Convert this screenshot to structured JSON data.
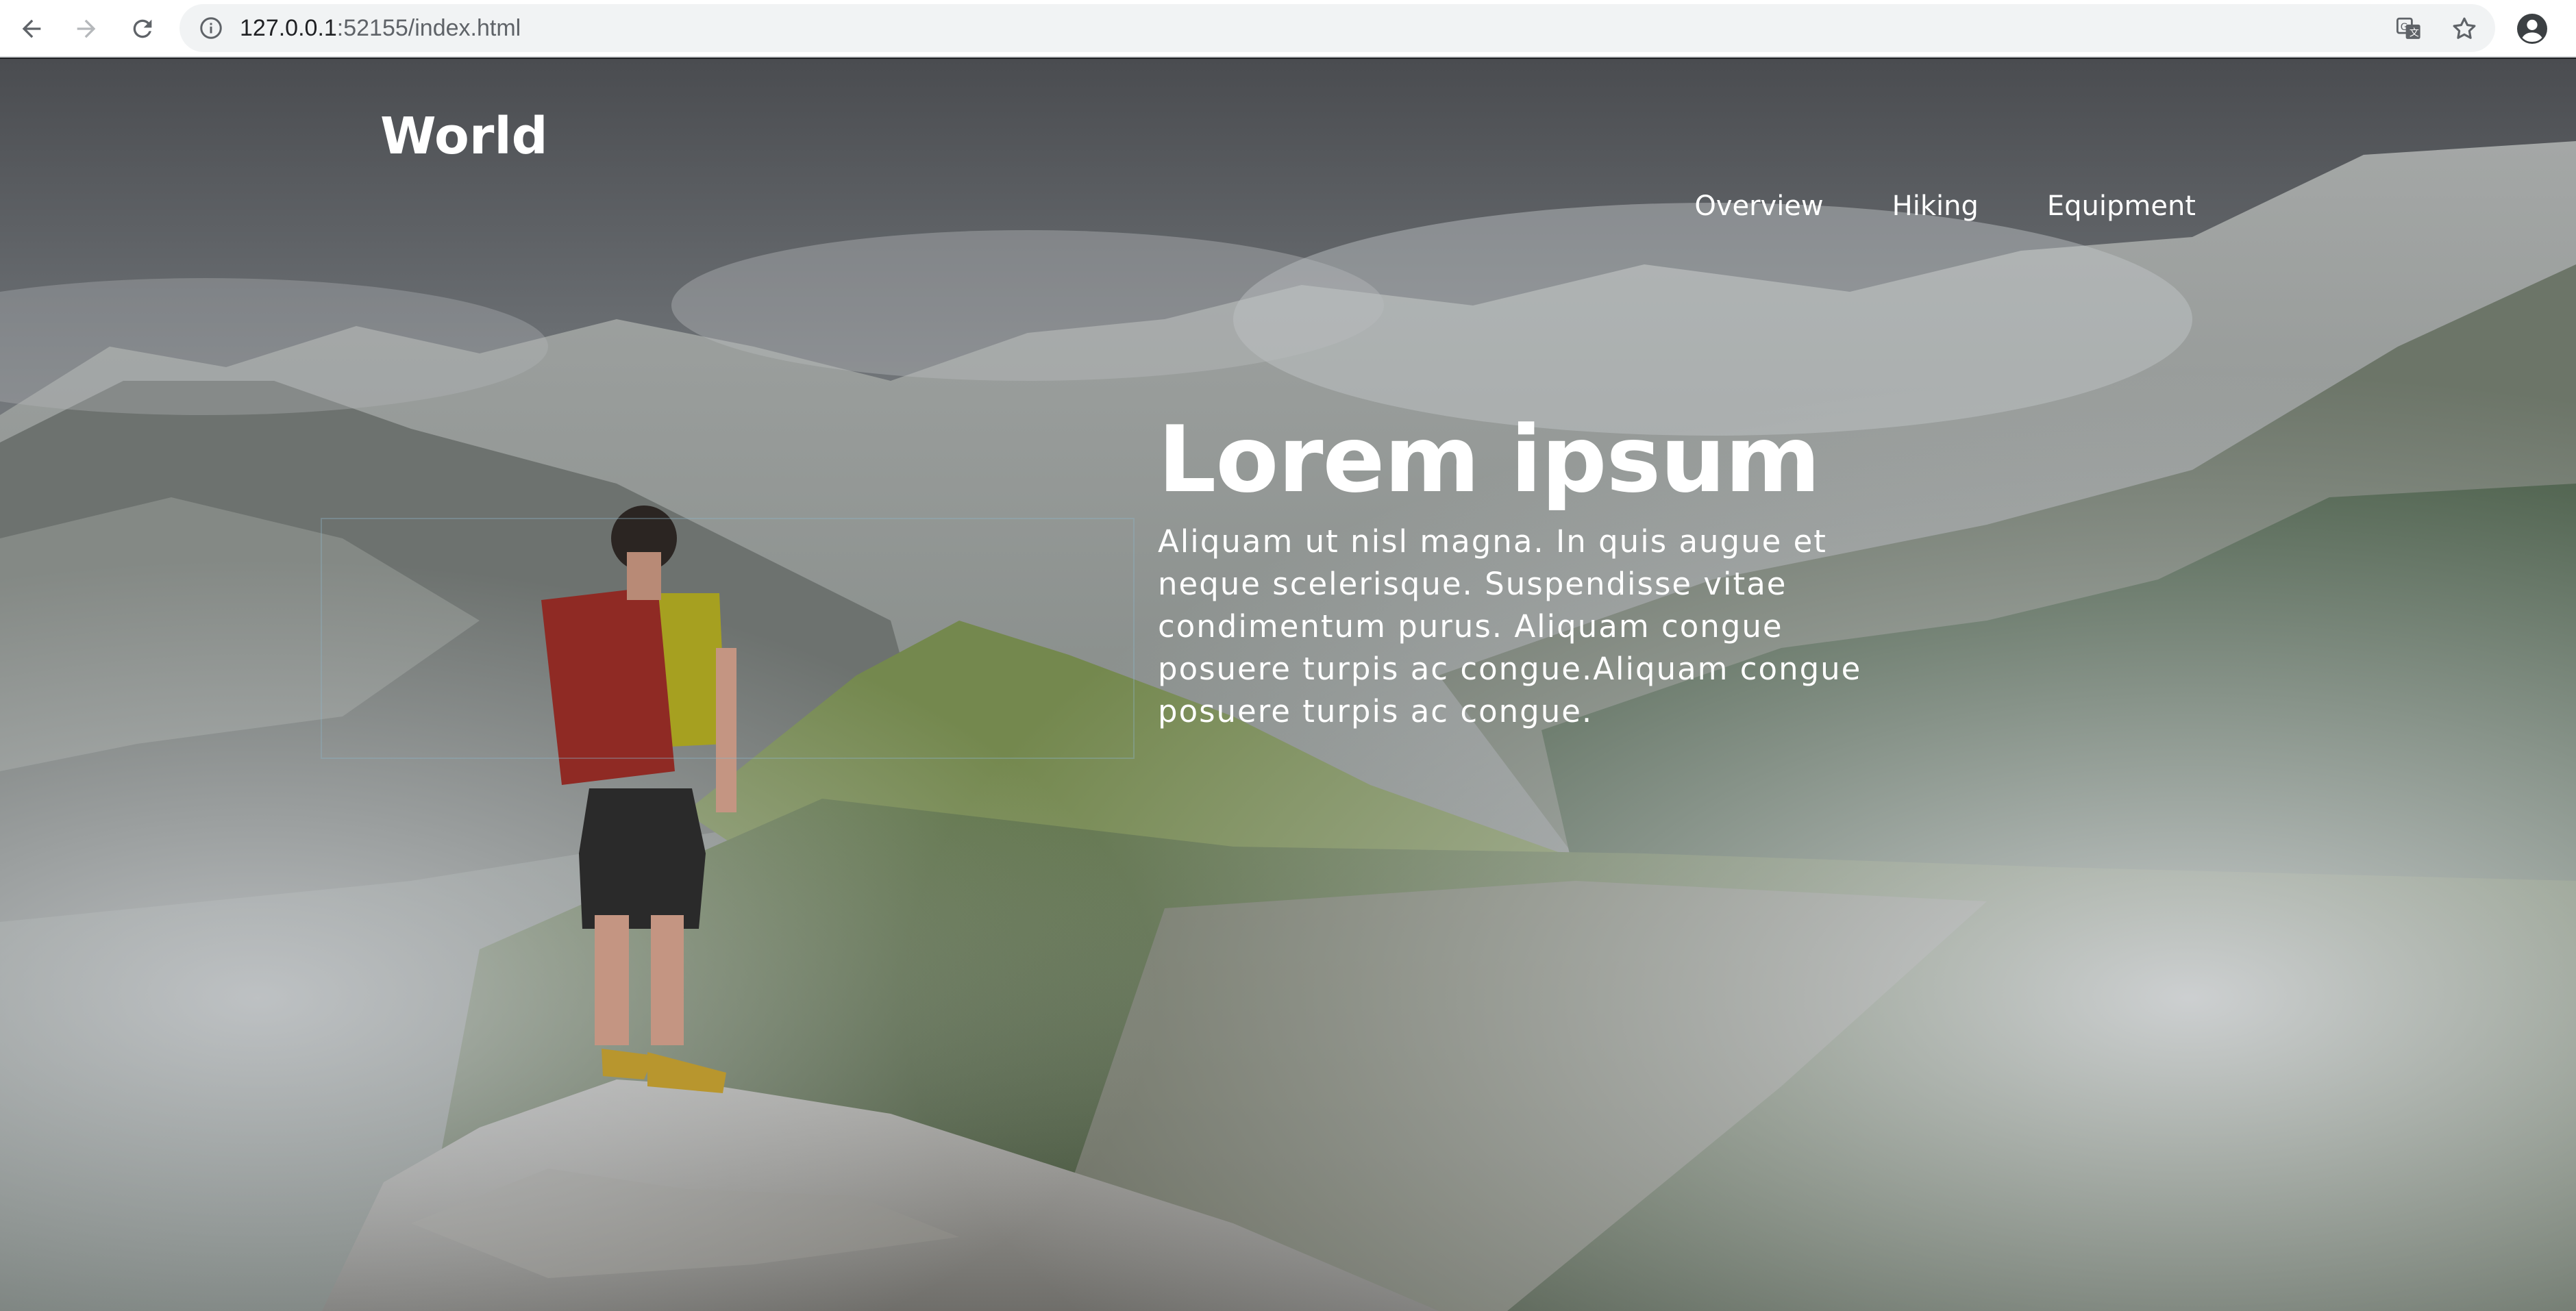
{
  "browser": {
    "url_host": "127.0.0.1",
    "url_path": ":52155/index.html",
    "icons": {
      "back": "arrow-left-icon",
      "forward": "arrow-right-icon",
      "reload": "reload-icon",
      "site_info": "info-icon",
      "translate": "translate-icon",
      "bookmark": "star-icon",
      "profile": "account-circle-icon"
    }
  },
  "site": {
    "logo": "World",
    "nav": [
      {
        "label": "Overview"
      },
      {
        "label": "Hiking"
      },
      {
        "label": "Equipment"
      }
    ]
  },
  "hero": {
    "title": "Lorem ipsum",
    "body": "Aliquam ut nisl magna. In quis augue et neque scelerisque. Suspendisse vitae condimentum purus. Aliquam congue posuere turpis ac congue.Aliquam congue posuere turpis ac congue.",
    "image": "hiker-on-mountain-peak-photo"
  },
  "colors": {
    "chrome_bg": "#ffffff",
    "omnibox_bg": "#f1f3f4",
    "hero_text": "#ffffff"
  }
}
